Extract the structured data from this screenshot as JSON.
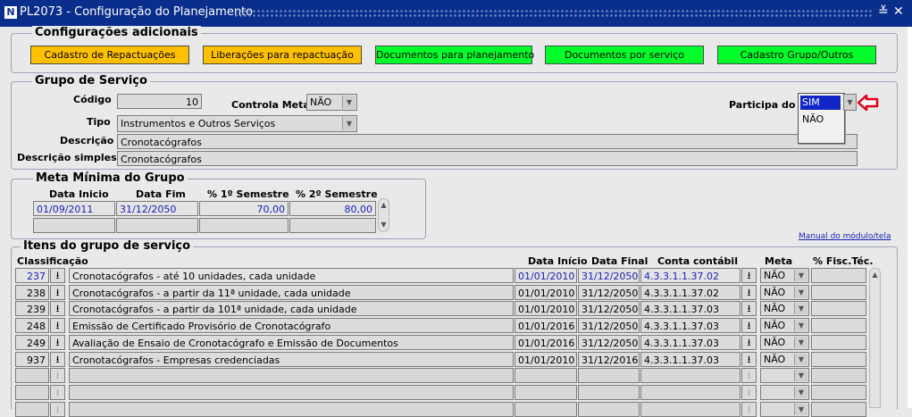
{
  "window": {
    "title": "PL2073 - Configuração do Planejamento",
    "app_icon_letter": "N",
    "controls": [
      "≚",
      "✕"
    ]
  },
  "config": {
    "title": "Configurações adicionais",
    "buttons": [
      {
        "label": "Cadastro de Repactuações",
        "color": "#ffc000"
      },
      {
        "label": "Liberações para repactuação",
        "color": "#ffc000"
      },
      {
        "label": "Documentos para planejamento",
        "color": "#00ff2a"
      },
      {
        "label": "Documentos por serviço",
        "color": "#00ff2a"
      },
      {
        "label": "Cadastro Grupo/Outros",
        "color": "#00ff2a"
      }
    ]
  },
  "grupo": {
    "title": "Grupo de Serviço",
    "codigo_label": "Código",
    "codigo": "10",
    "controla_meta_label": "Controla Meta",
    "controla_meta": "NÃO",
    "participa_label": "Participa do IP",
    "participa_options": [
      "SIM",
      "NÃO"
    ],
    "participa_selected": "SIM",
    "tipo_label": "Tipo",
    "tipo": "Instrumentos e Outros Serviços",
    "descricao_label": "Descrição",
    "descricao": "Cronotacógrafos",
    "descricao_simples_label": "Descrição simples",
    "descricao_simples": "Cronotacógrafos"
  },
  "meta": {
    "title": "Meta Mínima do Grupo",
    "headers": [
      "Data Inicio",
      "Data Fim",
      "% 1º Semestre",
      "% 2º Semestre"
    ],
    "row": {
      "data_inicio": "01/09/2011",
      "data_fim": "31/12/2050",
      "sem1": "70,00",
      "sem2": "80,00"
    }
  },
  "itens": {
    "title": "Itens do grupo de serviço",
    "manual_link": "Manual do módulo/tela",
    "headers": {
      "classificacao": "Classificação",
      "data_inicio": "Data Início",
      "data_final": "Data Final",
      "conta": "Conta contábil",
      "meta": "Meta",
      "fisc": "% Fisc.Téc."
    },
    "rows": [
      {
        "cod": "237",
        "desc": "Cronotacógrafos - até 10 unidades, cada unidade",
        "ini": "01/01/2010",
        "fim": "31/12/2050",
        "conta": "4.3.3.1.1.37.02",
        "meta": "NÃO",
        "fisc": ""
      },
      {
        "cod": "238",
        "desc": "Cronotacógrafos - a partir da 11ª unidade, cada unidade",
        "ini": "01/01/2010",
        "fim": "31/12/2050",
        "conta": "4.3.3.1.1.37.02",
        "meta": "NÃO",
        "fisc": ""
      },
      {
        "cod": "239",
        "desc": "Cronotacógrafos - a partir da 101ª unidade, cada unidade",
        "ini": "01/01/2010",
        "fim": "31/12/2050",
        "conta": "4.3.3.1.1.37.03",
        "meta": "NÃO",
        "fisc": ""
      },
      {
        "cod": "248",
        "desc": "Emissão de Certificado Provisório de Cronotacógrafo",
        "ini": "01/01/2016",
        "fim": "31/12/2050",
        "conta": "4.3.3.1.1.37.03",
        "meta": "NÃO",
        "fisc": ""
      },
      {
        "cod": "249",
        "desc": "Avaliação de Ensaio de Cronotacógrafo e Emissão de Documentos",
        "ini": "01/01/2016",
        "fim": "31/12/2050",
        "conta": "4.3.3.1.1.37.03",
        "meta": "NÃO",
        "fisc": ""
      },
      {
        "cod": "937",
        "desc": "Cronotacógrafos - Empresas credenciadas",
        "ini": "01/01/2010",
        "fim": "31/12/2016",
        "conta": "4.3.3.1.1.37.03",
        "meta": "NÃO",
        "fisc": ""
      }
    ]
  },
  "icons": {
    "download": "download-icon",
    "pointer": "red-arrow-icon"
  },
  "colors": {
    "titlebar": "#0a2e8c",
    "field_text_blue": "#1a22b8",
    "pointer": "#e0001b"
  }
}
